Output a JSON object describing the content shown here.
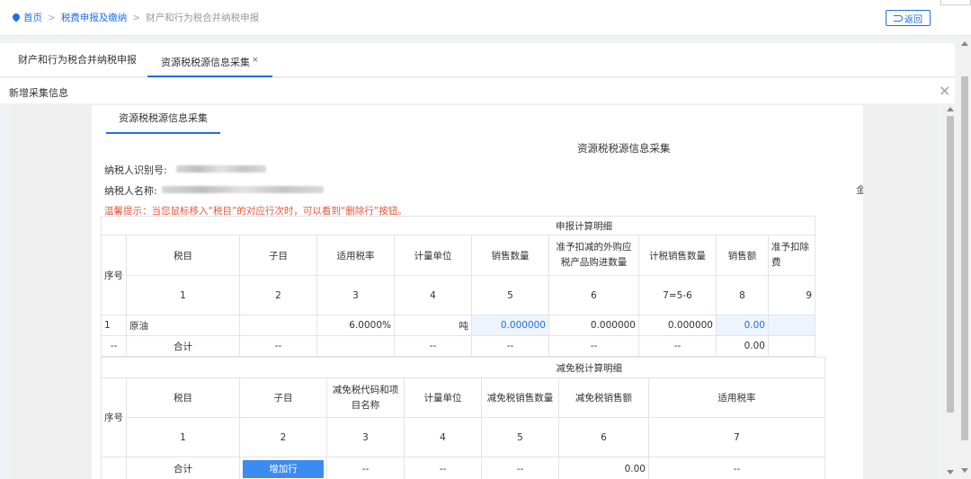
{
  "breadcrumb": {
    "home": "首页",
    "level2": "税费申报及缴纳",
    "level3": "财产和行为税合并纳税申报"
  },
  "back_button": "返回",
  "tabs": [
    {
      "label": "财产和行为税合并纳税申报"
    },
    {
      "label": "资源税税源信息采集",
      "close": "×"
    }
  ],
  "modal": {
    "title": "新增采集信息",
    "close": "×"
  },
  "panel": {
    "tab": "资源税税源信息采集",
    "form_title": "资源税税源信息采集",
    "taxpayer_id_label": "纳税人识别号:",
    "taxpayer_name_label": "纳税人名称:",
    "edge_char": "金",
    "tip": "温馨提示：当您鼠标移入“税目”的对应行次时，可以看到“删除行”按钮。"
  },
  "table1": {
    "section_title": "申报计算明细",
    "seq_header": "序号",
    "headers": [
      "税目",
      "子目",
      "适用税率",
      "计量单位",
      "销售数量",
      "准予扣减的外购应税产品购进数量",
      "计税销售数量",
      "销售额",
      "准予扣除费"
    ],
    "numbers": [
      "1",
      "2",
      "3",
      "4",
      "5",
      "6",
      "7=5-6",
      "8",
      "9"
    ],
    "row": {
      "seq": "1",
      "item": "原油",
      "subitem": "",
      "rate": "6.0000%",
      "unit": "吨",
      "sales_qty": "0.000000",
      "deduct_qty": "0.000000",
      "tax_qty": "0.000000",
      "sales_amt": "0.00",
      "deduct_fee": ""
    },
    "total": {
      "seq": "--",
      "label": "合计",
      "subitem": "--",
      "rate": "",
      "unit": "--",
      "sales_qty": "--",
      "deduct_qty": "--",
      "tax_qty": "--",
      "sales_amt": "0.00",
      "deduct_fee": ""
    }
  },
  "table2": {
    "section_title": "减免税计算明细",
    "seq_header": "序号",
    "headers": [
      "税目",
      "子目",
      "减免税代码和项目名称",
      "计量单位",
      "减免税销售数量",
      "减免税销售额",
      "适用税率"
    ],
    "numbers": [
      "1",
      "2",
      "3",
      "4",
      "5",
      "6",
      "7"
    ],
    "total": {
      "label": "合计",
      "add_button": "增加行",
      "c3": "--",
      "c4": "--",
      "c5": "--",
      "c6": "0.00",
      "c7": "--"
    }
  },
  "colors": {
    "accent": "#1e6fe3",
    "tip": "#e8553c"
  }
}
